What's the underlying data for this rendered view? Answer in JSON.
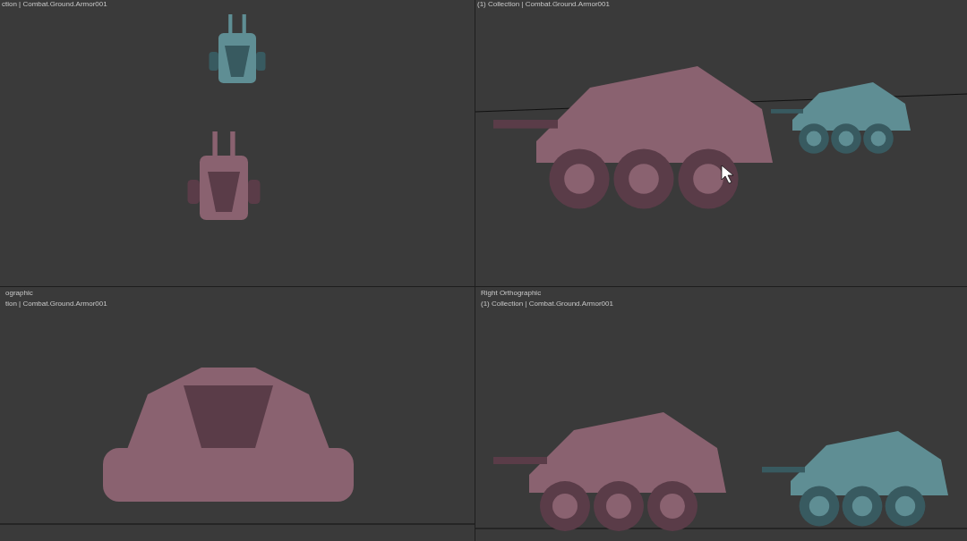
{
  "viewports": [
    {
      "labels": [
        "ction | Combat.Ground.Armor001"
      ],
      "cursor": false
    },
    {
      "labels": [
        "(1) Collection | Combat.Ground.Armor001"
      ],
      "cursor": true
    },
    {
      "labels": [
        "ographic",
        "tion | Combat.Ground.Armor001"
      ],
      "cursor": false
    },
    {
      "labels": [
        "Right Orthographic",
        "(1) Collection | Combat.Ground.Armor001"
      ],
      "cursor": false
    }
  ]
}
